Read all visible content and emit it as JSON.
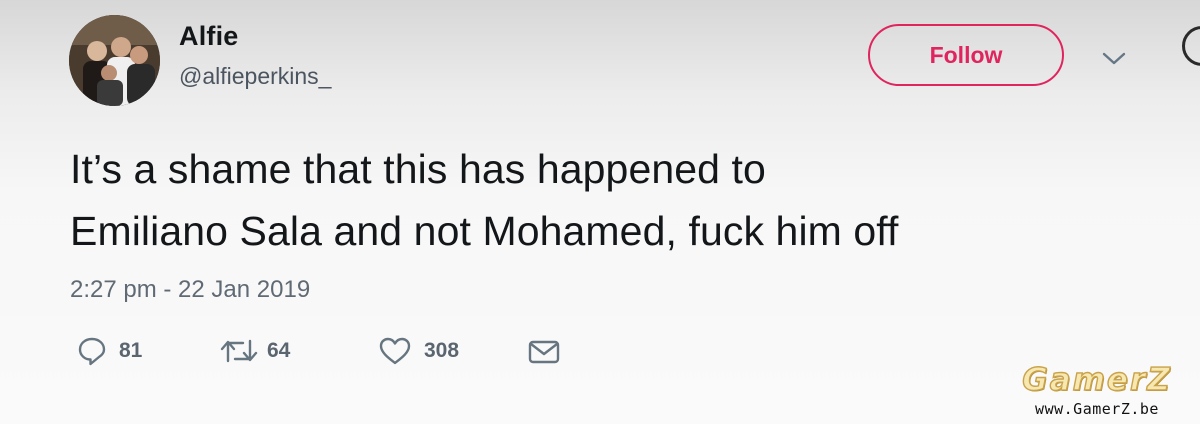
{
  "user": {
    "display_name": "Alfie",
    "username": "@alfieperkins_"
  },
  "header": {
    "follow_label": "Follow"
  },
  "tweet": {
    "text_lines": [
      "It’s a shame that this has happened to",
      "Emiliano Sala and not Mohamed, fuck him off"
    ],
    "timestamp": "2:27 pm - 22 Jan 2019"
  },
  "actions": {
    "reply_count": "81",
    "retweet_count": "64",
    "like_count": "308"
  },
  "icons": {
    "reply": "speech-bubble",
    "retweet": "retweet-arrows",
    "like": "heart-outline",
    "dm": "envelope",
    "caret": "chevron-down"
  },
  "colors": {
    "follow_accent": "#e0245e",
    "text": "#14171a",
    "muted": "#5f6a74"
  },
  "watermark": {
    "logo": "GamerZ",
    "url": "www.GamerZ.be"
  }
}
